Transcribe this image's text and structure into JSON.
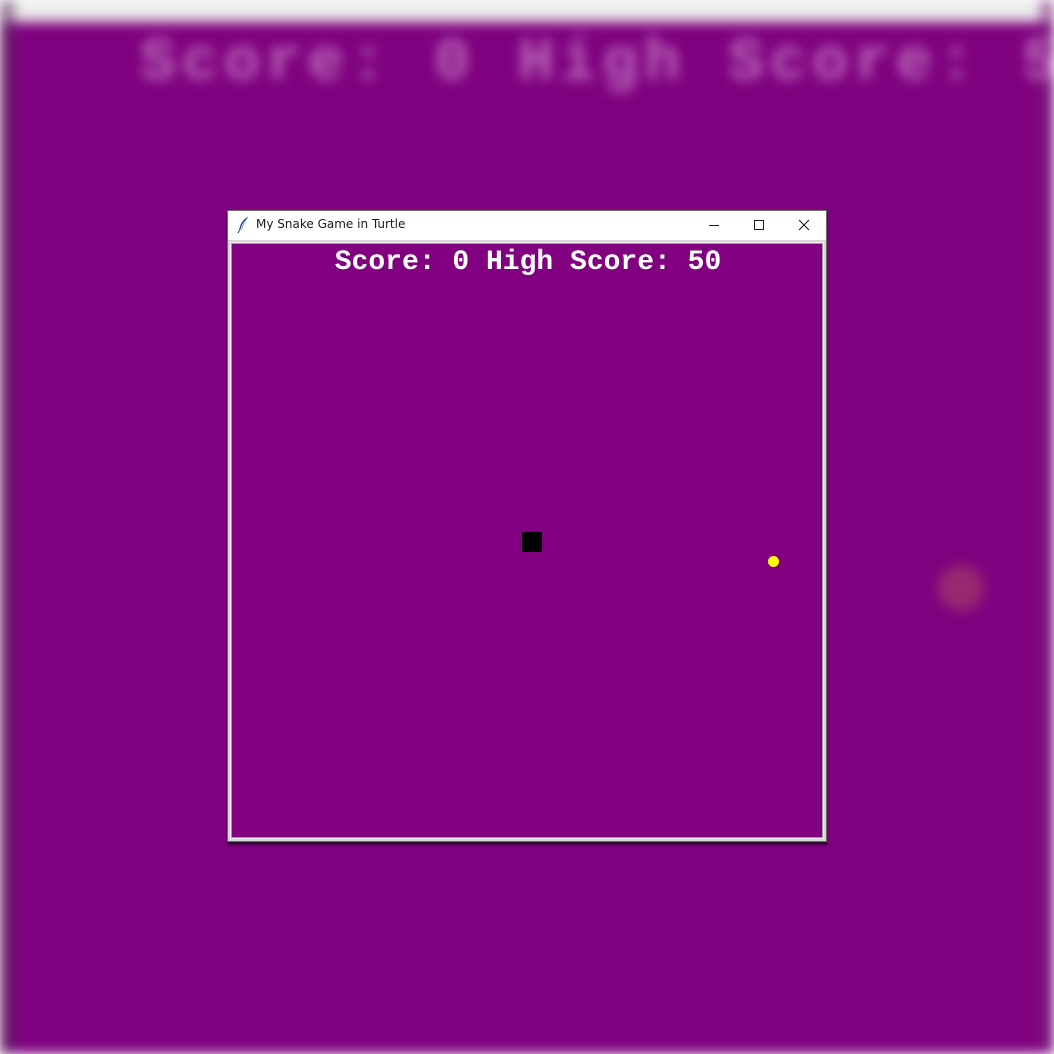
{
  "window": {
    "title": "My Snake Game in Turtle",
    "controls": {
      "minimize_icon": "minimize-icon",
      "maximize_icon": "maximize-icon",
      "close_icon": "close-icon"
    }
  },
  "game": {
    "score_label": "Score:",
    "score_value": "0",
    "high_score_label": "High Score:",
    "high_score_value": "50",
    "score_text": "Score: 0 High Score: 50",
    "background_color": "#800080",
    "snake_color": "#000000",
    "food_color": "#ffff00",
    "text_color": "#ffffff"
  }
}
